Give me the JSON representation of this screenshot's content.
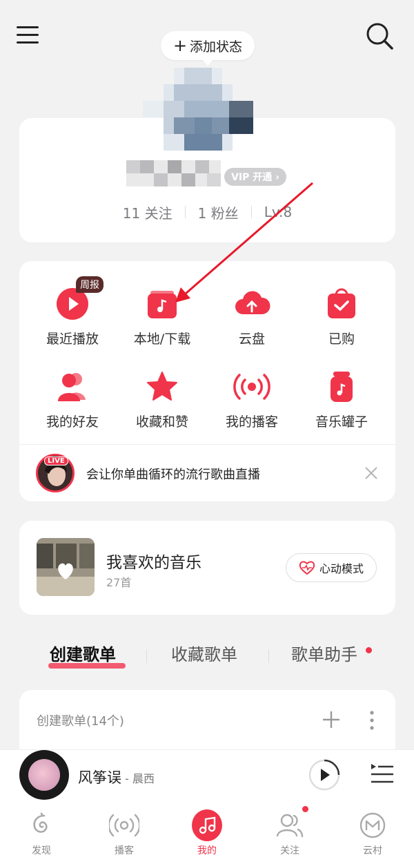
{
  "header": {
    "status_label": "添加状态",
    "vip_label": "VIP 开通 ›"
  },
  "profile": {
    "follow_count": "11",
    "follow_label": "关注",
    "fans_count": "1",
    "fans_label": "粉丝",
    "level": "Lv.8"
  },
  "grid": {
    "items": [
      {
        "label": "最近播放",
        "icon": "play-icon",
        "badge": "周报"
      },
      {
        "label": "本地/下载",
        "icon": "music-folder-icon"
      },
      {
        "label": "云盘",
        "icon": "cloud-upload-icon"
      },
      {
        "label": "已购",
        "icon": "shopping-bag-icon"
      },
      {
        "label": "我的好友",
        "icon": "friends-icon"
      },
      {
        "label": "收藏和赞",
        "icon": "star-icon"
      },
      {
        "label": "我的播客",
        "icon": "broadcast-icon"
      },
      {
        "label": "音乐罐子",
        "icon": "music-jar-icon"
      }
    ]
  },
  "live": {
    "tag": "LIVE",
    "text": "会让你单曲循环的流行歌曲直播"
  },
  "favorites": {
    "title": "我喜欢的音乐",
    "count": "27首",
    "mode_label": "心动模式"
  },
  "tabs": {
    "items": [
      "创建歌单",
      "收藏歌单",
      "歌单助手"
    ],
    "active": 0
  },
  "playlists": {
    "header": "创建歌单(14个)"
  },
  "player": {
    "song": "风筝误",
    "artist": " - 晨西"
  },
  "nav": {
    "items": [
      "发现",
      "播客",
      "我的",
      "关注",
      "云村"
    ],
    "active": 2
  },
  "colors": {
    "accent": "#f0344a",
    "background": "#f2f2f3",
    "annotation_arrow": "#e8192c"
  }
}
